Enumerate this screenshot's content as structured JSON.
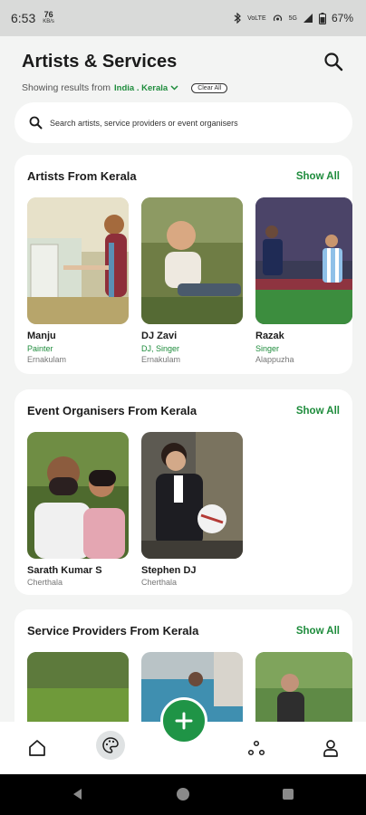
{
  "status_bar": {
    "time": "6:53",
    "speed_value": "76",
    "speed_unit": "KB/s",
    "network_1": "VoLTE",
    "network_2": "5G",
    "battery": "67%"
  },
  "header": {
    "title": "Artists & Services",
    "showing_prefix": "Showing results from",
    "location": "India . Kerala",
    "clear_label": "Clear All"
  },
  "search": {
    "placeholder": "Search artists, service providers or event organisers"
  },
  "sections": {
    "artists": {
      "title": "Artists From Kerala",
      "show_all": "Show All",
      "items": [
        {
          "name": "Manju",
          "role": "Painter",
          "place": "Ernakulam"
        },
        {
          "name": "DJ Zavi",
          "role": "DJ, Singer",
          "place": "Ernakulam"
        },
        {
          "name": "Razak",
          "role": "Singer",
          "place": "Alappuzha"
        }
      ]
    },
    "organisers": {
      "title": "Event Organisers From Kerala",
      "show_all": "Show All",
      "items": [
        {
          "name": "Sarath Kumar S",
          "place": "Cherthala"
        },
        {
          "name": "Stephen DJ",
          "place": "Cherthala"
        }
      ]
    },
    "providers": {
      "title": "Service Providers From Kerala",
      "show_all": "Show All"
    }
  },
  "colors": {
    "accent": "#1e8c3c",
    "fab": "#1f9446",
    "background": "#f3f4f3"
  },
  "bottom_nav": {
    "icons": [
      "home-icon",
      "artists-palette-icon",
      "add-icon",
      "services-icon",
      "profile-icon"
    ]
  }
}
